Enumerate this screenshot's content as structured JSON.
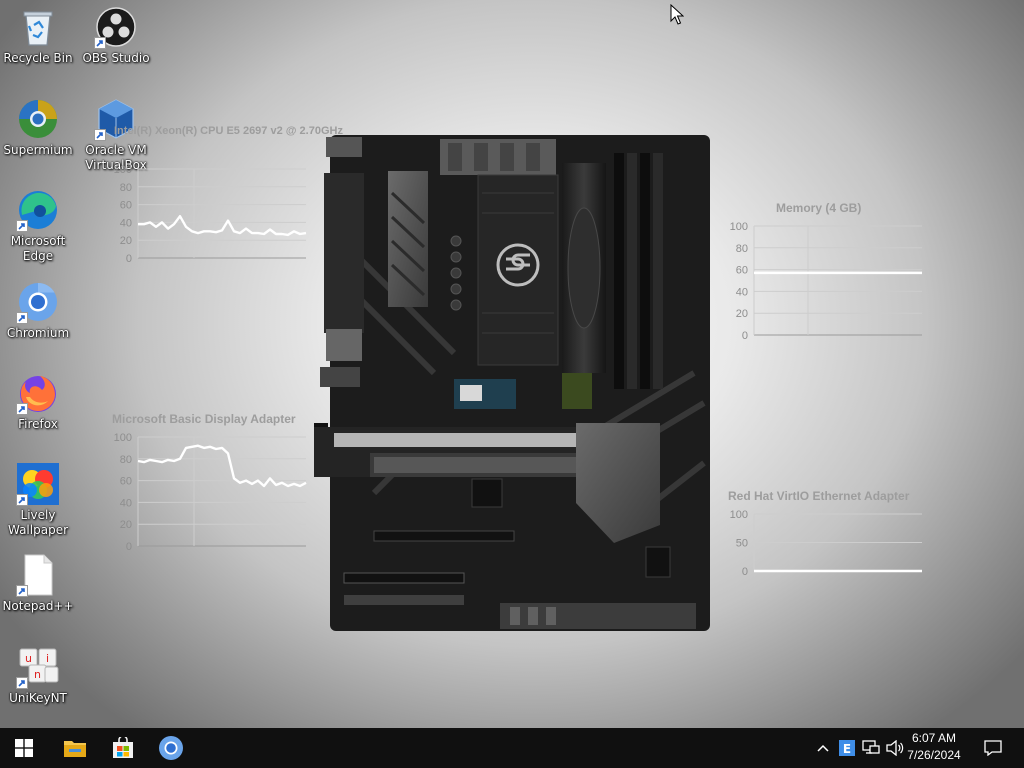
{
  "desktop_icons": [
    {
      "id": "recycle-bin",
      "label": "Recycle Bin",
      "icon": "recycle-bin-icon"
    },
    {
      "id": "obs-studio",
      "label": "OBS Studio",
      "icon": "obs-icon"
    },
    {
      "id": "supermium",
      "label": "Supermium",
      "icon": "supermium-icon"
    },
    {
      "id": "virtualbox",
      "label": "Oracle VM VirtualBox",
      "icon": "virtualbox-icon"
    },
    {
      "id": "edge",
      "label": "Microsoft Edge",
      "icon": "edge-icon"
    },
    {
      "id": "chromium",
      "label": "Chromium",
      "icon": "chromium-icon"
    },
    {
      "id": "firefox",
      "label": "Firefox",
      "icon": "firefox-icon"
    },
    {
      "id": "lively",
      "label": "Lively Wallpaper",
      "icon": "lively-icon"
    },
    {
      "id": "notepadpp",
      "label": "Notepad++",
      "icon": "notepad-icon"
    },
    {
      "id": "unikey",
      "label": "UniKeyNT",
      "icon": "unikey-icon"
    }
  ],
  "widgets": {
    "cpu": {
      "title": "Intel(R) Xeon(R) CPU E5 2697 v2 @ 2.70GHz",
      "y_ticks": [
        "100",
        "80",
        "60",
        "40",
        "20",
        "0"
      ],
      "values": [
        38,
        38,
        40,
        35,
        40,
        33,
        38,
        47,
        35,
        30,
        28,
        30,
        30,
        29,
        31,
        42,
        30,
        28,
        33,
        28,
        28,
        27,
        32,
        27,
        27,
        26,
        30,
        27,
        28
      ]
    },
    "gpu": {
      "title": "Microsoft Basic Display Adapter",
      "y_ticks": [
        "100",
        "80",
        "60",
        "40",
        "20",
        "0"
      ],
      "values": [
        78,
        77,
        79,
        78,
        77,
        79,
        78,
        80,
        90,
        91,
        92,
        90,
        91,
        89,
        90,
        85,
        62,
        58,
        60,
        57,
        60,
        55,
        62,
        56,
        58,
        55,
        57,
        55,
        58
      ]
    },
    "memory": {
      "title": "Memory (4 GB)",
      "y_ticks": [
        "100",
        "80",
        "60",
        "40",
        "20",
        "0"
      ],
      "value": 57
    },
    "network": {
      "title": "Red Hat VirtIO Ethernet Adapter",
      "y_ticks": [
        "100",
        "50",
        "0"
      ],
      "value": 0
    }
  },
  "taskbar": {
    "pinned": [
      "start-icon",
      "file-explorer-icon",
      "store-icon",
      "chromium-icon"
    ],
    "time": "6:07 AM",
    "date": "7/26/2024"
  },
  "colors": {
    "taskbar": "#101010",
    "graph_line": "#ffffff",
    "grid": "#bcbcbc",
    "widget_text": "#9d9d9d"
  }
}
